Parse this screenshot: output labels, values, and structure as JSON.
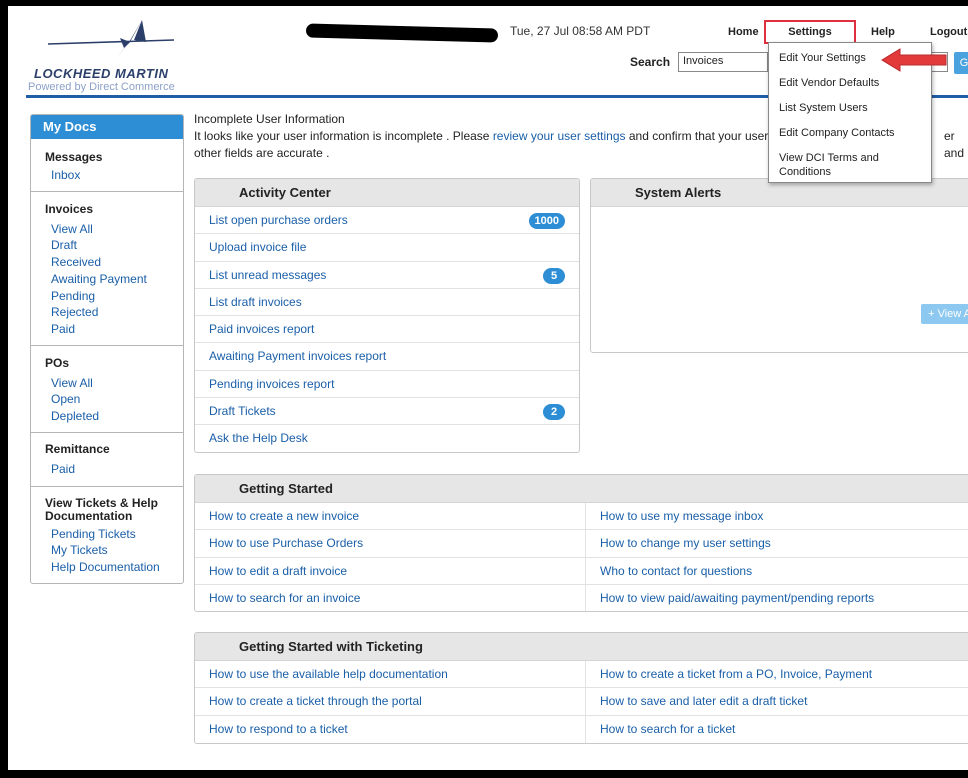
{
  "header": {
    "brand": "LOCKHEED MARTIN",
    "powered_by": "Powered by Direct Commerce",
    "datetime": "Tue, 27 Jul 08:58 AM PDT",
    "nav": {
      "home": "Home",
      "settings": "Settings",
      "help": "Help",
      "logout": "Logout"
    },
    "search_label": "Search",
    "search_scope": "Invoices",
    "search_go": "G"
  },
  "settings_menu": {
    "items": [
      "Edit Your Settings",
      "Edit Vendor Defaults",
      "List System Users",
      "Edit Company Contacts",
      "View DCI Terms and Conditions"
    ]
  },
  "sidebar": {
    "title": "My Docs",
    "messages": {
      "heading": "Messages",
      "links": [
        "Inbox"
      ]
    },
    "invoices": {
      "heading": "Invoices",
      "links": [
        "View All",
        "Draft",
        "Received",
        "Awaiting Payment",
        "Pending",
        "Rejected",
        "Paid"
      ]
    },
    "pos": {
      "heading": "POs",
      "links": [
        "View All",
        "Open",
        "Depleted"
      ]
    },
    "remittance": {
      "heading": "Remittance",
      "links": [
        "Paid"
      ]
    },
    "tickets": {
      "heading": "View Tickets & Help Documentation",
      "links": [
        "Pending Tickets",
        "My Tickets",
        "Help Documentation"
      ]
    }
  },
  "notice": {
    "title": "Incomplete User Information",
    "text_before": "It looks like your user information is incomplete . Please ",
    "link": "review your user settings",
    "text_after": " and confirm that your usernar",
    "text_tail": "er and",
    "line2": "other fields are accurate ."
  },
  "activity_center": {
    "title": "Activity Center",
    "items": [
      {
        "label": "List open purchase orders",
        "badge": "1000"
      },
      {
        "label": "Upload invoice file",
        "badge": ""
      },
      {
        "label": "List unread messages",
        "badge": "5"
      },
      {
        "label": "List draft invoices",
        "badge": ""
      },
      {
        "label": "Paid invoices report",
        "badge": ""
      },
      {
        "label": "Awaiting Payment invoices report",
        "badge": ""
      },
      {
        "label": "Pending invoices report",
        "badge": ""
      },
      {
        "label": "Draft Tickets",
        "badge": "2"
      },
      {
        "label": "Ask the Help Desk",
        "badge": ""
      }
    ]
  },
  "system_alerts": {
    "title": "System Alerts",
    "view_all": "+ View All"
  },
  "getting_started": {
    "title": "Getting Started",
    "rows": [
      [
        "How to create a new invoice",
        "How to use my message inbox"
      ],
      [
        "How to use Purchase Orders",
        "How to change my user settings"
      ],
      [
        "How to edit a draft invoice",
        "Who to contact for questions"
      ],
      [
        "How to search for an invoice",
        "How to view paid/awaiting payment/pending reports"
      ]
    ]
  },
  "ticketing": {
    "title": "Getting Started with Ticketing",
    "rows": [
      [
        "How to use the available help documentation",
        "How to create a ticket from a PO, Invoice, Payment"
      ],
      [
        "How to create a ticket through the portal",
        "How to save and later edit a draft ticket"
      ],
      [
        "How to respond to a ticket",
        "How to search for a ticket"
      ]
    ]
  }
}
